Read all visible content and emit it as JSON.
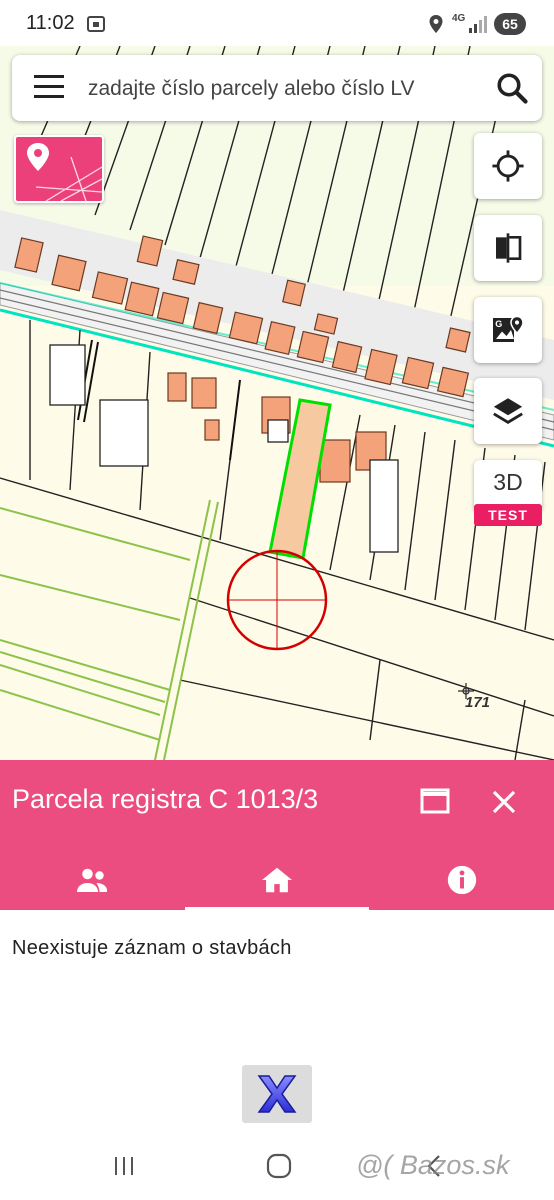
{
  "status_bar": {
    "time": "11:02",
    "network": "4G",
    "battery": "65"
  },
  "search": {
    "placeholder": "zadajte číslo parcely alebo číslo LV"
  },
  "map": {
    "parcel_number": "171",
    "highlight_color": "#f7c9a0",
    "accent": "#00e5c0"
  },
  "toolbar": {
    "mode_3d_label": "3D",
    "test_badge": "TEST"
  },
  "panel": {
    "title": "Parcela registra C 1013/3",
    "tabs": [
      "owners",
      "buildings",
      "info"
    ],
    "active_tab": "buildings",
    "message": "Neexistuje záznam o stavbách",
    "header_color": "#ec4d80"
  },
  "watermark": "@( Bazos.sk"
}
